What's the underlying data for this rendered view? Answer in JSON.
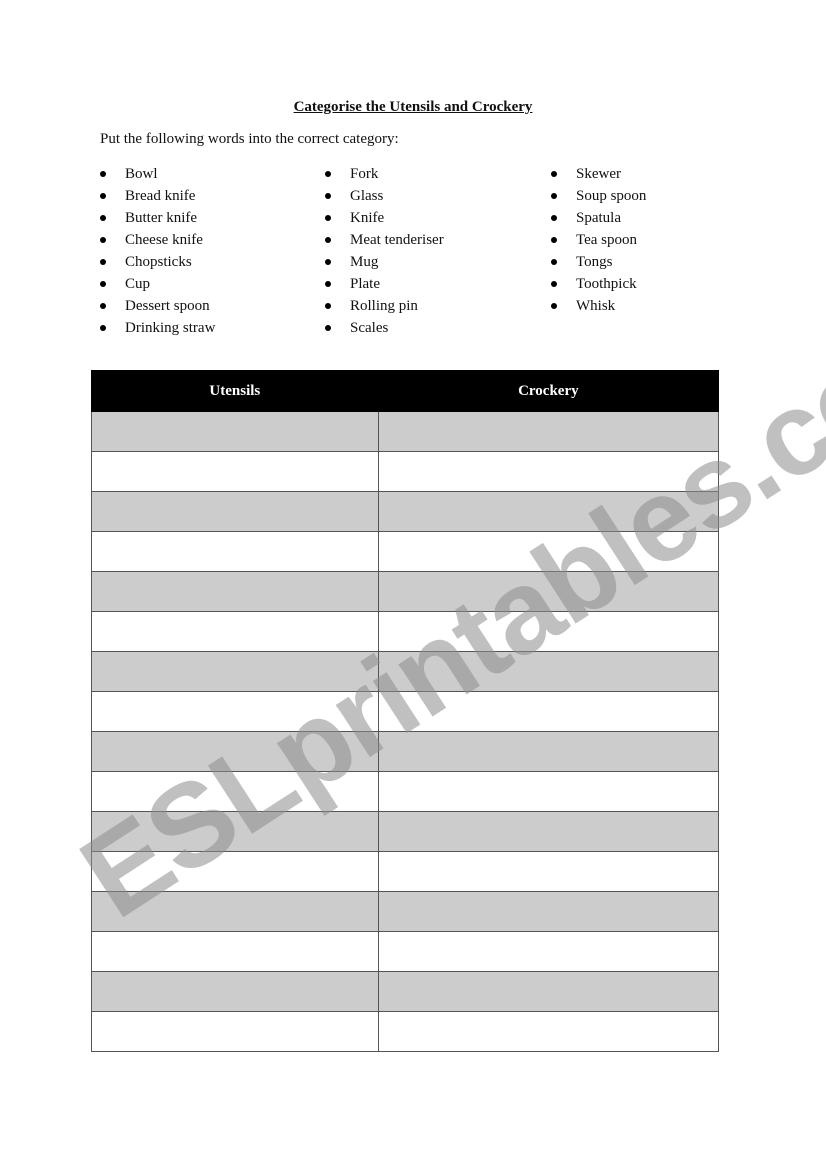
{
  "document": {
    "title": "Categorise the Utensils and Crockery",
    "instruction": "Put the following words into the correct category:"
  },
  "word_list": {
    "column_1": [
      "Bowl",
      "Bread knife",
      "Butter knife",
      "Cheese knife",
      "Chopsticks",
      "Cup",
      "Dessert spoon",
      "Drinking straw"
    ],
    "column_2": [
      "Fork",
      "Glass",
      "Knife",
      "Meat tenderiser",
      "Mug",
      "Plate",
      "Rolling pin",
      "Scales"
    ],
    "column_3": [
      "Skewer",
      "Soup spoon",
      "Spatula",
      "Tea spoon",
      "Tongs",
      "Toothpick",
      "Whisk"
    ]
  },
  "table": {
    "headers": [
      "Utensils",
      "Crockery"
    ],
    "row_count": 16,
    "colors": {
      "header_bg": "#000000",
      "header_text": "#ffffff",
      "shaded_row": "#cccccc",
      "plain_row": "#ffffff"
    }
  },
  "watermark": {
    "text": "ESLprintables.com"
  }
}
